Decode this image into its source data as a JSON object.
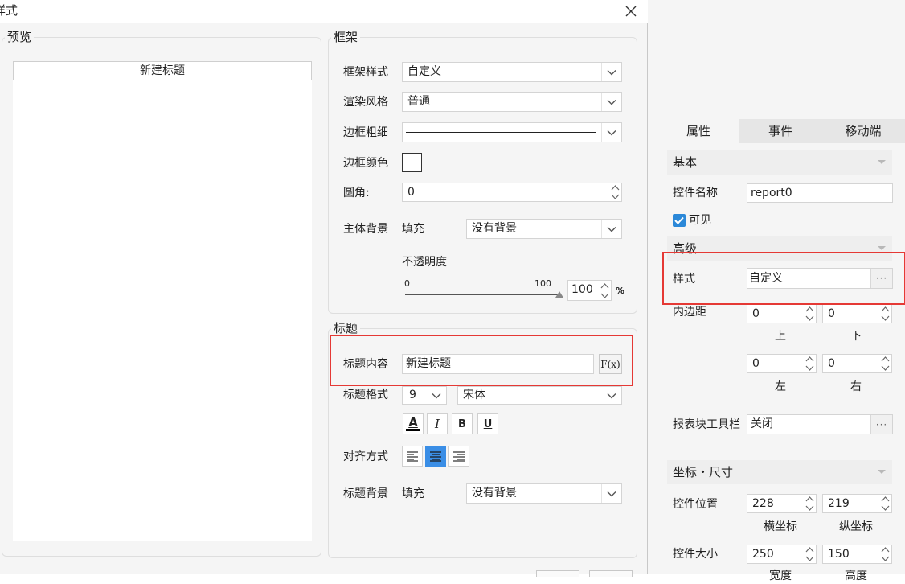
{
  "dialog": {
    "title": "样式",
    "close_symbol": "✕",
    "preview": {
      "group_title": "预览",
      "sample_title": "新建标题"
    },
    "frame": {
      "group_title": "框架",
      "frame_style": {
        "label": "框架样式",
        "value": "自定义"
      },
      "render_style": {
        "label": "渲染风格",
        "value": "普通"
      },
      "border_width": {
        "label": "边框粗细"
      },
      "border_color": {
        "label": "边框颜色",
        "color": "#ffffff"
      },
      "corner_radius": {
        "label": "圆角:",
        "value": "0"
      },
      "body_background": {
        "label": "主体背景",
        "fill_label": "填充",
        "value": "没有背景"
      },
      "opacity": {
        "label": "不透明度",
        "min": "0",
        "max": "100",
        "value": "100",
        "percent": "%",
        "level": 1.0
      }
    },
    "title_section": {
      "group_title": "标题",
      "content": {
        "label": "标题内容",
        "value": "新建标题",
        "fx_label": "F(x)"
      },
      "format": {
        "label": "标题格式",
        "size": "9",
        "font": "宋体"
      },
      "format_buttons": {
        "color": "A",
        "italic": "I",
        "bold": "B",
        "underline": "U",
        "color_value": "#000000"
      },
      "align": {
        "label": "对齐方式",
        "selected": "center"
      },
      "background": {
        "label": "标题背景",
        "fill_label": "填充",
        "value": "没有背景"
      }
    }
  },
  "props_panel": {
    "tabs": [
      {
        "label": "属性",
        "active": true
      },
      {
        "label": "事件",
        "active": false
      },
      {
        "label": "移动端",
        "active": false
      }
    ],
    "basic": {
      "header": "基本",
      "name": {
        "label": "控件名称",
        "value": "report0"
      },
      "visible": {
        "label": "可见",
        "checked": true
      }
    },
    "advanced": {
      "header": "高级",
      "style": {
        "label": "样式",
        "value": "自定义"
      },
      "padding": {
        "label": "内边距",
        "top": {
          "value": "0",
          "caption": "上"
        },
        "bottom": {
          "value": "0",
          "caption": "下"
        },
        "left": {
          "value": "0",
          "caption": "左"
        },
        "right": {
          "value": "0",
          "caption": "右"
        }
      },
      "toolbar": {
        "label": "报表块工具栏",
        "value": "关闭"
      }
    },
    "coords": {
      "header": "坐标・尺寸",
      "position": {
        "label": "控件位置",
        "x": "228",
        "y": "219",
        "x_caption": "横坐标",
        "y_caption": "纵坐标"
      },
      "size": {
        "label": "控件大小",
        "w": "250",
        "h": "150",
        "w_caption": "宽度",
        "h_caption": "高度"
      }
    }
  },
  "colors": {
    "highlight_red": "#e53935",
    "accent_blue": "#2b88d8",
    "panel_bg": "#f5f5f5"
  }
}
